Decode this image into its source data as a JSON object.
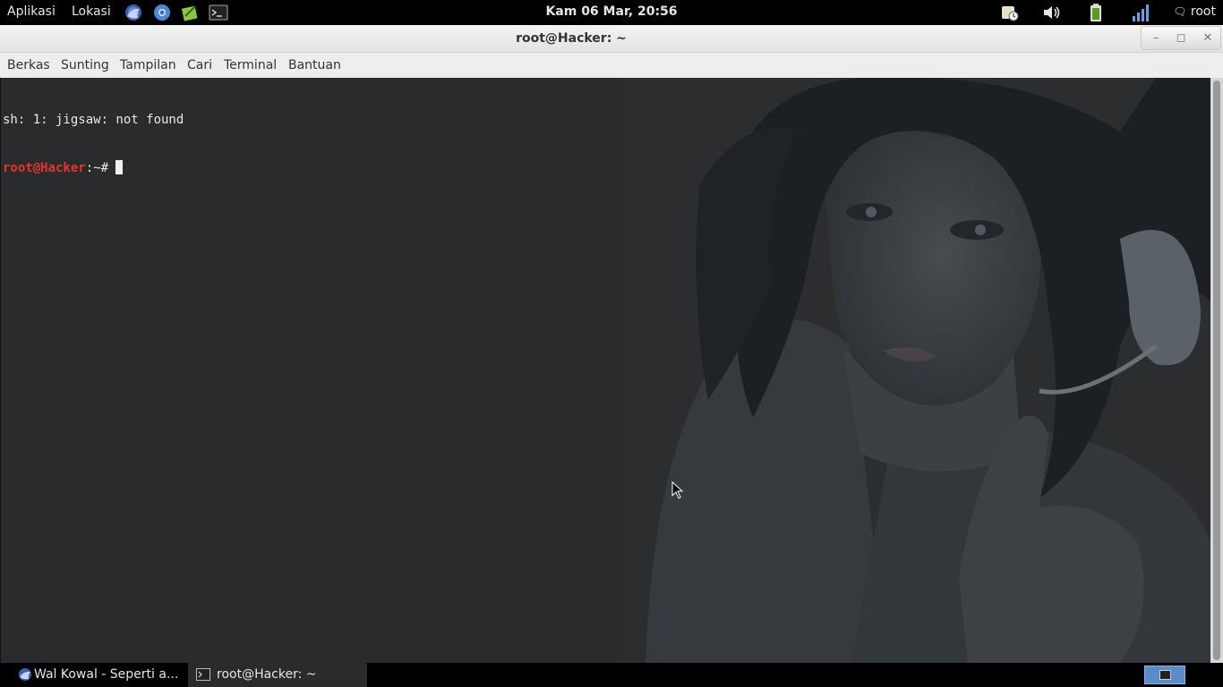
{
  "top_panel": {
    "applications_label": "Aplikasi",
    "places_label": "Lokasi",
    "launchers": [
      "iceweasel-icon",
      "chromium-icon",
      "leafpad-icon",
      "terminal-icon"
    ],
    "clock": "Kam 06 Mar, 20:56",
    "tray": [
      "updates-icon",
      "volume-icon",
      "battery-icon",
      "network-signal-icon"
    ],
    "user_label": "root"
  },
  "window": {
    "title": "root@Hacker: ~",
    "controls": [
      "minimize",
      "maximize",
      "close"
    ]
  },
  "menubar": {
    "items": [
      "Berkas",
      "Sunting",
      "Tampilan",
      "Cari",
      "Terminal",
      "Bantuan"
    ]
  },
  "terminal": {
    "line1": "sh: 1: jigsaw: not found",
    "prompt_user": "root@Hacker",
    "prompt_path": ":~# ",
    "colors": {
      "background": "#2a2b2c",
      "prompt": "#e8342f",
      "text": "#e8e8e8"
    }
  },
  "taskbar": {
    "tasks": [
      {
        "label": "Wal Kowal - Seperti a...",
        "icon": "iceweasel-icon",
        "active": false
      },
      {
        "label": "root@Hacker: ~",
        "icon": "terminal-icon",
        "active": true
      }
    ]
  }
}
